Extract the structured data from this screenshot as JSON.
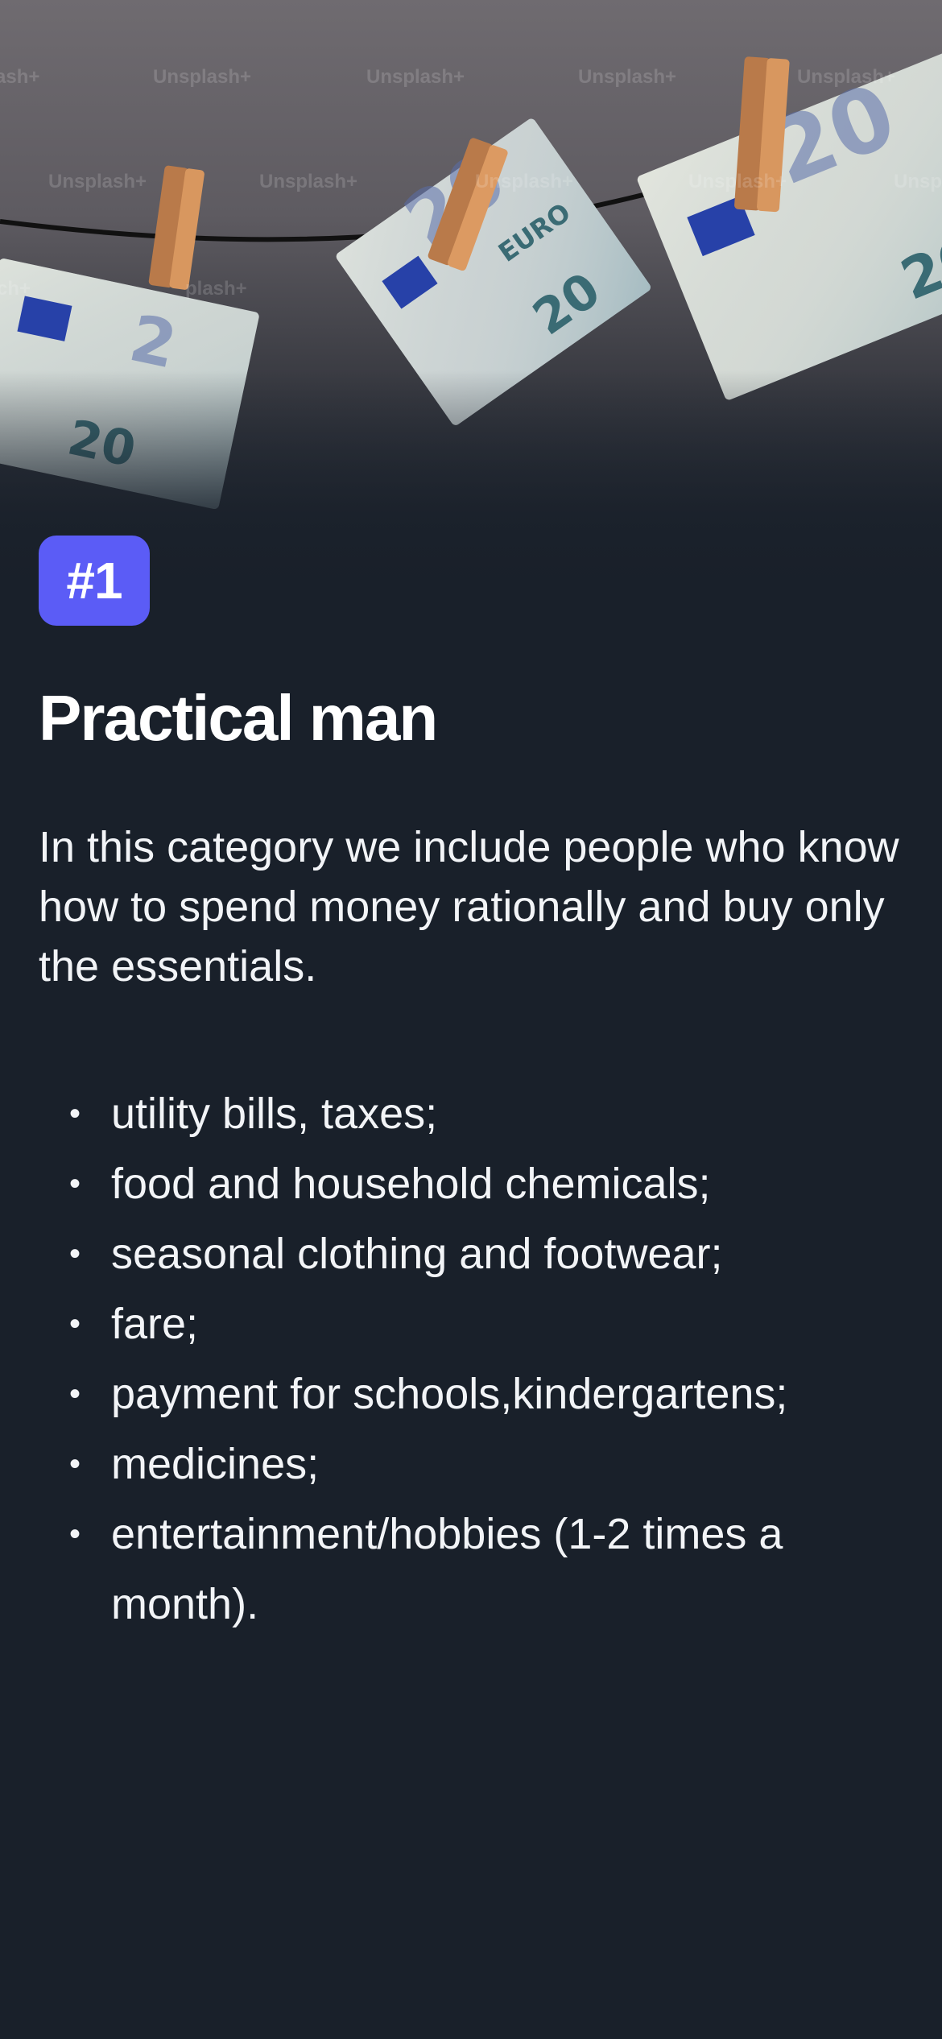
{
  "hero": {
    "watermark_texts": [
      "ash+",
      "Unsplash+",
      "Unsplash+",
      "Unsplash+",
      "Unsplash+",
      "Unsplash+",
      "Unsplash+",
      "Unsplash+",
      "Unsplash+",
      "Unsplash+",
      "ch+",
      "plash+"
    ],
    "banknote_labels": [
      "20",
      "20",
      "20"
    ],
    "banknote_brand": "EURO"
  },
  "badge": {
    "label": "#1",
    "color": "#5b5cf6"
  },
  "title": "Practical man",
  "description": "In this category we include people who know how to spend money rationally and buy only the essentials.",
  "items": [
    "utility bills, taxes;",
    "food and household chemicals;",
    "seasonal clothing and footwear;",
    "fare;",
    "payment for schools,kindergartens;",
    "medicines;",
    "entertainment/hobbies (1-2 times a month)."
  ],
  "bullet_char": "•",
  "colors": {
    "background": "#19202a",
    "accent": "#5b5cf6",
    "text": "#ffffff"
  }
}
